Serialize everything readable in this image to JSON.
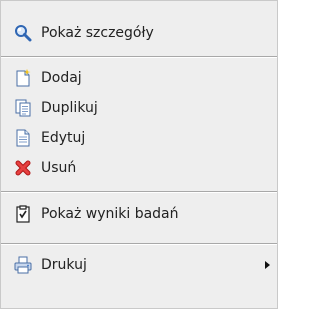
{
  "menu": {
    "show_details": {
      "label": "Pokaż szczegóły",
      "icon": "magnifier-icon"
    },
    "add": {
      "label": "Dodaj",
      "icon": "new-document-icon"
    },
    "duplicate": {
      "label": "Duplikuj",
      "icon": "copy-documents-icon"
    },
    "edit": {
      "label": "Edytuj",
      "icon": "document-icon"
    },
    "delete": {
      "label": "Usuń",
      "icon": "red-x-icon"
    },
    "show_results": {
      "label": "Pokaż wyniki badań",
      "icon": "results-icon"
    },
    "print": {
      "label": "Drukuj",
      "icon": "printer-icon",
      "has_submenu": true
    }
  },
  "colors": {
    "background": "#eeeeee",
    "separator": "#a8a8a8",
    "delete_icon": "#e02828",
    "icon_blue": "#3a72c4"
  }
}
